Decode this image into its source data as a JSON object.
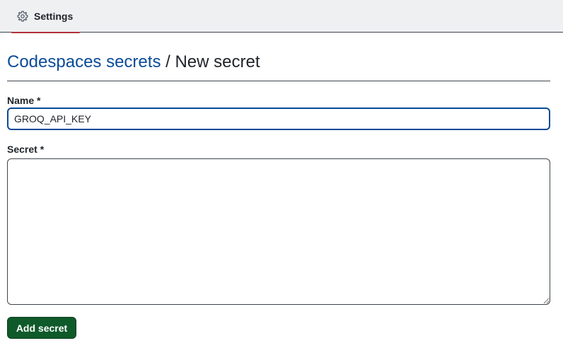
{
  "nav": {
    "tab_label": "Settings",
    "tab_icon": "gear-icon",
    "active_tab_accent": "#b0323a"
  },
  "heading": {
    "link_text": "Codespaces secrets",
    "separator": "/",
    "current_text": "New secret",
    "link_color": "#0a4b97"
  },
  "form": {
    "name_label": "Name *",
    "name_value": "GROQ_API_KEY",
    "secret_label": "Secret *",
    "secret_value": "",
    "submit_label": "Add secret",
    "submit_color": "#0f5a2a"
  }
}
